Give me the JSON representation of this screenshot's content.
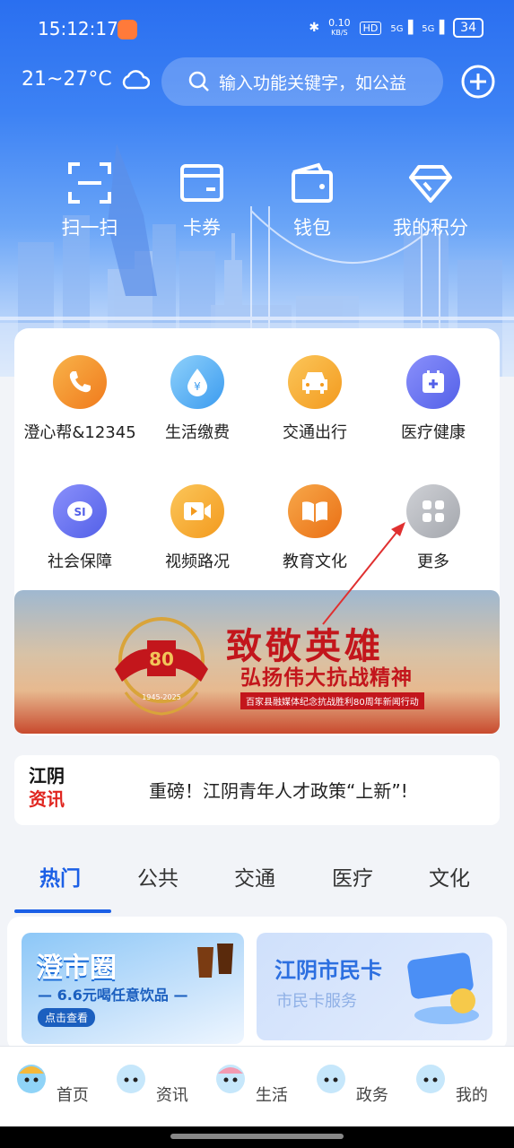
{
  "status_bar": {
    "time": "15:12:17",
    "speed": "0.10",
    "speed_unit": "KB/S",
    "hd": "HD",
    "net1": "5G",
    "net2": "5G",
    "battery": "34"
  },
  "header": {
    "weather": "21~27°C",
    "search_placeholder": "输入功能关键字，如公益"
  },
  "quick_actions": [
    {
      "label": "扫一扫",
      "icon": "scan-icon"
    },
    {
      "label": "卡券",
      "icon": "card-icon"
    },
    {
      "label": "钱包",
      "icon": "wallet-icon"
    },
    {
      "label": "我的积分",
      "icon": "diamond-icon"
    }
  ],
  "services": [
    {
      "label": "澄心帮&12345",
      "icon": "phone-icon",
      "color": "#f59a2a"
    },
    {
      "label": "生活缴费",
      "icon": "water-drop-icon",
      "color": "#5fb4f5"
    },
    {
      "label": "交通出行",
      "icon": "car-icon",
      "color": "#f5a937"
    },
    {
      "label": "医疗健康",
      "icon": "calendar-plus-icon",
      "color": "#6a72f0"
    },
    {
      "label": "社会保障",
      "icon": "social-security-icon",
      "color": "#6a72f0"
    },
    {
      "label": "视频路况",
      "icon": "video-icon",
      "color": "#f5a937"
    },
    {
      "label": "教育文化",
      "icon": "book-icon",
      "color": "#f08a2a"
    },
    {
      "label": "更多",
      "icon": "grid-icon",
      "color": "#b9bcc2"
    }
  ],
  "banner": {
    "title": "致敬英雄",
    "subtitle": "弘扬伟大抗战精神",
    "caption": "百家县融媒体纪念抗战胜利80周年新闻行动",
    "emblem_number": "80",
    "emblem_years": "1945-2025"
  },
  "news": {
    "logo_line1": "江阴",
    "logo_line2": "资讯",
    "headline": "重磅！江阴青年人才政策“上新”!"
  },
  "tabs": [
    "热门",
    "公共",
    "交通",
    "医疗",
    "文化"
  ],
  "promos": {
    "left": {
      "title": "澄市圈",
      "subtitle": "— 6.6元喝任意饮品 —",
      "button": "点击查看"
    },
    "right": {
      "title": "江阴市民卡",
      "subtitle": "市民卡服务"
    }
  },
  "bottom_nav": [
    "首页",
    "资讯",
    "生活",
    "政务",
    "我的"
  ]
}
